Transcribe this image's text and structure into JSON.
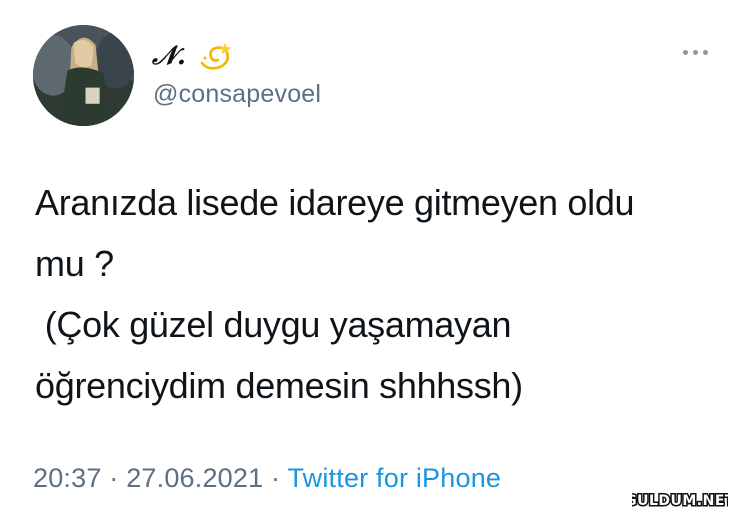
{
  "author": {
    "display_name": "𝒩.",
    "name_emoji_icon": "dizzy-icon",
    "handle": "@consapevoel",
    "avatar_icon": "profile-photo"
  },
  "more_icon": "more-horizontal-icon",
  "tweet": {
    "lines": [
      "Aranızda lisede idareye gitmeyen oldu",
      "mu ?",
      " (Çok güzel duygu yaşamayan",
      "öğrenciydim demesin shhhssh)"
    ]
  },
  "meta": {
    "time": "20:37",
    "separator": " · ",
    "date": "27.06.2021",
    "source": "Twitter for iPhone"
  },
  "watermark": {
    "text": "GULDUM.NET"
  },
  "colors": {
    "text": "#0f1419",
    "secondary": "#5b7083",
    "link": "#1b95e0"
  }
}
